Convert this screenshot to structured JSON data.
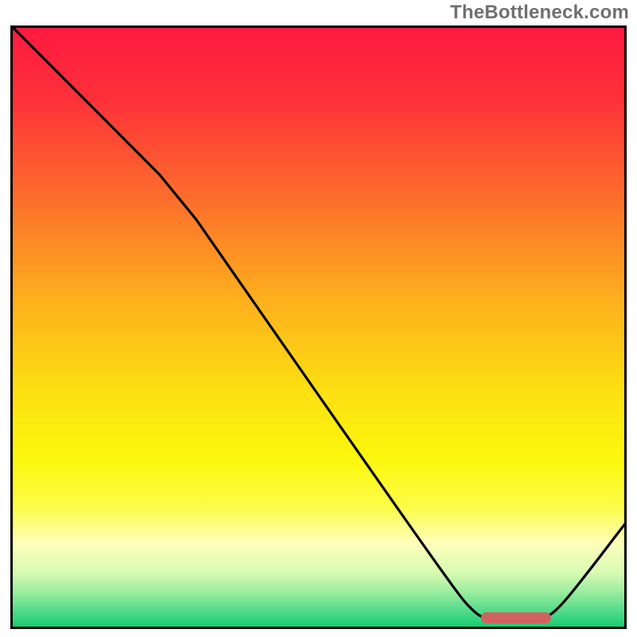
{
  "watermark": "TheBottleneck.com",
  "plot": {
    "inner_width": 768,
    "inner_height": 752
  },
  "gradient": {
    "stops": [
      {
        "offset_pct": 0,
        "color": "#fe1a40"
      },
      {
        "offset_pct": 12,
        "color": "#fd3139"
      },
      {
        "offset_pct": 28,
        "color": "#fc6c2c"
      },
      {
        "offset_pct": 45,
        "color": "#fcae1d"
      },
      {
        "offset_pct": 60,
        "color": "#fcde12"
      },
      {
        "offset_pct": 72,
        "color": "#fcf80d"
      },
      {
        "offset_pct": 80,
        "color": "#fcfc48"
      },
      {
        "offset_pct": 86,
        "color": "#feffbb"
      },
      {
        "offset_pct": 91,
        "color": "#d7fab2"
      },
      {
        "offset_pct": 94,
        "color": "#9eeea1"
      },
      {
        "offset_pct": 97,
        "color": "#5bdd8b"
      },
      {
        "offset_pct": 100,
        "color": "#17cd73"
      }
    ]
  },
  "chart_data": {
    "type": "line",
    "title": "",
    "xlabel": "",
    "ylabel": "",
    "xlim": [
      0,
      100
    ],
    "ylim": [
      0,
      100
    ],
    "note": "Axis units are percentages of the plot area (no tick labels shown). y=100 at top, y=0 at bottom.",
    "series": [
      {
        "name": "curve",
        "points": [
          {
            "x": 0.1,
            "y": 100.0
          },
          {
            "x": 24.0,
            "y": 75.5
          },
          {
            "x": 30.0,
            "y": 68.0
          },
          {
            "x": 68.0,
            "y": 12.0
          },
          {
            "x": 75.0,
            "y": 3.0
          },
          {
            "x": 78.5,
            "y": 1.2
          },
          {
            "x": 82.0,
            "y": 0.9
          },
          {
            "x": 86.0,
            "y": 1.3
          },
          {
            "x": 90.0,
            "y": 4.0
          },
          {
            "x": 100.0,
            "y": 17.0
          }
        ]
      }
    ],
    "marker": {
      "name": "target-range",
      "x_start_pct": 76.5,
      "x_end_pct": 88.0,
      "y_pct": 1.4,
      "color": "#d0625f"
    }
  }
}
